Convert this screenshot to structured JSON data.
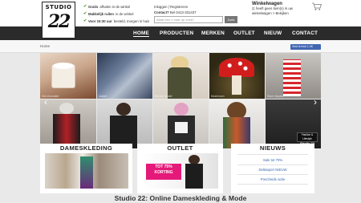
{
  "logo": {
    "word": "STUDIO",
    "number": "22"
  },
  "usps": [
    {
      "bold": "Gratis",
      "text": "afhalen in de winkel"
    },
    {
      "bold": "Makkelijk ruilen",
      "text": "in de winkel"
    },
    {
      "bold": "Voor 15:30 uur",
      "text": "besteld, morgen in huis"
    }
  ],
  "account": {
    "login": "Inloggen",
    "separator": " | ",
    "register": "Registreren",
    "contact_label": "Contact?",
    "contact_phone": "Bel 0413-331437"
  },
  "search": {
    "placeholder": "Waar ben u naar op zoek?",
    "button": "Zoek"
  },
  "cart": {
    "title": "Winkelwagen",
    "count_text": "(1 heeft geen item(s) in uw",
    "line2": "winkelwagen",
    "view": "> Bekijken"
  },
  "nav": [
    "HOME",
    "PRODUCTEN",
    "MERKEN",
    "OUTLET",
    "NIEUW",
    "CONTACT"
  ],
  "breadcrumb": "Home",
  "facebook": {
    "label": "Vind ik leuk",
    "count": "1,3K"
  },
  "grid": [
    {
      "name": "hot-chocolate-photo",
      "label": "Hot chocolate"
    },
    {
      "name": "jacket-photo",
      "label": "Jacket"
    },
    {
      "name": "blonde-model-photo",
      "label": "Blonde model"
    },
    {
      "name": "mushroom-photo",
      "label": "Mushroom"
    },
    {
      "name": "store-display-photo",
      "label": "Store display"
    },
    {
      "name": "red-dress-model-photo",
      "label": "Model"
    },
    {
      "name": "leather-jacket-photo",
      "label": "Leather jacket"
    },
    {
      "name": "pink-hair-model-photo",
      "label": "Pink hair"
    },
    {
      "name": "wavy-hair-model-photo",
      "label": "Wavy hair"
    },
    {
      "name": "storefront-photo",
      "label": "Storefront"
    }
  ],
  "storefront_sign": {
    "line1": "Fashion & Lifestyle",
    "line2": "Studio 22"
  },
  "panels": {
    "dameskleding": "DAMESKLEDING",
    "outlet": "OUTLET",
    "outlet_promo": {
      "line1": "TOT 75%",
      "line2": "KORTING"
    },
    "nieuws": "NIEUWS",
    "news_items": [
      "Sale tot 70%",
      "Deltasport NIEUW",
      "Poncheide actie"
    ]
  },
  "footer": {
    "title": "Studio 22: Online Dameskleding & Mode"
  },
  "colors": {
    "nav": "#2b2b2b",
    "accent": "#e5197a",
    "link": "#3a66b0",
    "check": "#4a9a2e",
    "facebook": "#4267b2"
  }
}
